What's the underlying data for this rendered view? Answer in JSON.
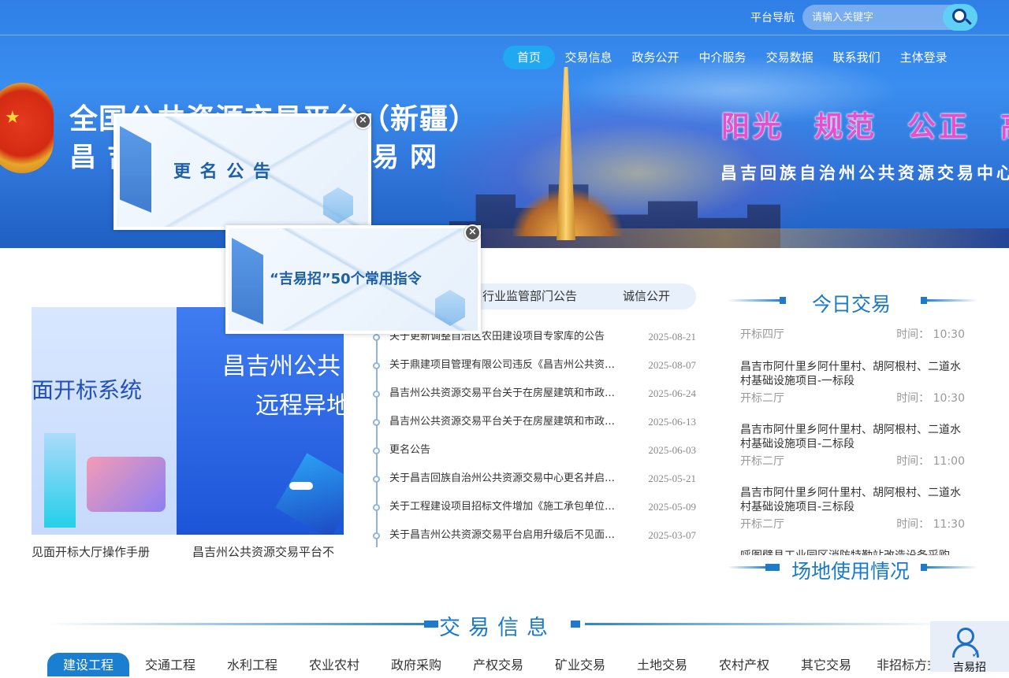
{
  "header": {
    "platform_nav": "平台导航",
    "search_placeholder": "请输入关键字",
    "nav": [
      "首页",
      "交易信息",
      "政务公开",
      "中介服务",
      "交易数据",
      "联系我们",
      "主体登录"
    ],
    "title_line1": "全国公共资源交易平台（新疆）",
    "title_line2": "昌吉州公共资源交易网",
    "slogan": [
      "阳光",
      "规范",
      "公正",
      "高效"
    ],
    "slogan_sub": "昌吉回族自治州公共资源交易中心"
  },
  "popups": [
    {
      "text": "更 名 公 告",
      "close": "×"
    },
    {
      "text": "“吉易招”50个常用指令",
      "close": "×"
    }
  ],
  "carousel": {
    "slide_a_text": "面开标系统",
    "slide_b_text1": "昌吉州公共",
    "slide_b_text2": "远程异地",
    "captions": [
      "见面开标大厅操作手册",
      "昌吉州公共资源交易平台不"
    ]
  },
  "notices": {
    "tabs": [
      "行业监管部门公告",
      "诚信公开"
    ],
    "items": [
      {
        "title": "关于更新调整自治区农田建设项目专家库的公告",
        "date": "2025-08-21"
      },
      {
        "title": "关于鼎建项目管理有限公司违反《昌吉州公共资源交易平台》规定的通报",
        "date": "2025-08-07"
      },
      {
        "title": "昌吉州公共资源交易平台关于在房屋建筑和市政工程中推行的通知",
        "date": "2025-06-24"
      },
      {
        "title": "昌吉州公共资源交易平台关于在房屋建筑和市政工程项目中的通知",
        "date": "2025-06-13"
      },
      {
        "title": "更名公告",
        "date": "2025-06-03"
      },
      {
        "title": "关于昌吉回族自治州公共资源交易中心更名并启用新印章的公告",
        "date": "2025-05-21"
      },
      {
        "title": "关于工程建设项目招标文件增加《施工承包单位承诺书》的通知",
        "date": "2025-05-09"
      },
      {
        "title": "关于昌吉州公共资源交易平台启用升级后不见面开标系统的通知",
        "date": "2025-03-07"
      }
    ]
  },
  "today": {
    "title": "今日交易",
    "time_label": "时间：",
    "items": [
      {
        "name": "",
        "room": "开标四厅",
        "time": "10:30"
      },
      {
        "name": "昌吉市阿什里乡阿什里村、胡阿根村、二道水村基础设施项目-一标段",
        "room": "开标二厅",
        "time": "10:30"
      },
      {
        "name": "昌吉市阿什里乡阿什里村、胡阿根村、二道水村基础设施项目-二标段",
        "room": "开标二厅",
        "time": "11:00"
      },
      {
        "name": "昌吉市阿什里乡阿什里村、胡阿根村、二道水村基础设施项目-三标段",
        "room": "开标二厅",
        "time": "11:30"
      },
      {
        "name": "呼图壁县工业园区消防特勤站改造设备采购",
        "room": "",
        "time": ""
      }
    ],
    "venue_title": "场地使用情况"
  },
  "trade_info": {
    "title": "交易信息",
    "tabs": [
      "建设工程",
      "交通工程",
      "水利工程",
      "农业农村",
      "政府采购",
      "产权交易",
      "矿业交易",
      "土地交易",
      "农村产权",
      "其它交易",
      "非招标方式"
    ]
  },
  "float_widget": {
    "label": "吉易招"
  }
}
